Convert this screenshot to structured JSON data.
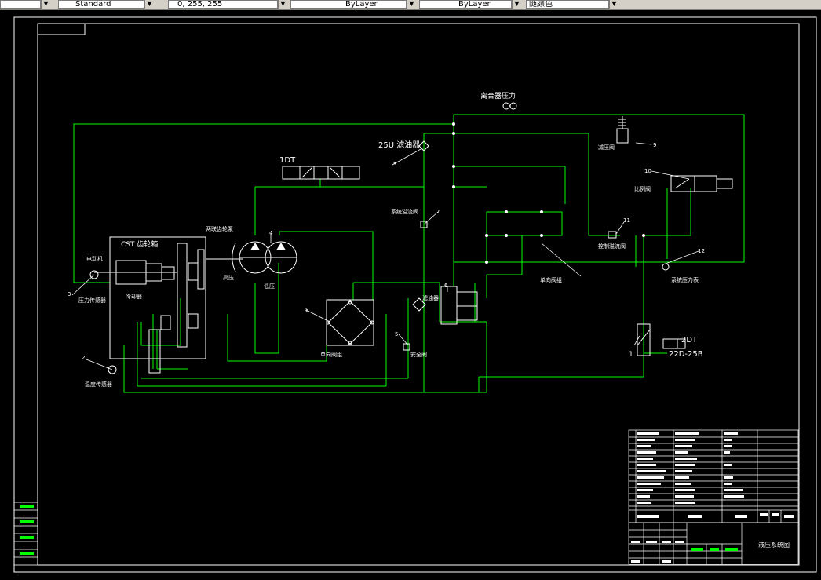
{
  "toolbar": {
    "textstyle_value": "Standard",
    "color_value": "0, 255, 255",
    "linetype_value": "ByLayer",
    "lineweight_value": "ByLayer",
    "plotstyle_value": "随颜色"
  },
  "diagram": {
    "title": "离合器压力",
    "labels": {
      "filter_25u": "25U 滤油器",
      "solenoid_1dt": "1DT",
      "cst": "CST 齿轮箱",
      "dual_pump": "两联齿轮泵",
      "high_pressure": "高压",
      "low_pressure": "低压",
      "system_overflow_valve": "系统溢流阀",
      "check_valve_group_mid": "单向阀组",
      "check_valve_group_right": "单向阀组",
      "safety_valve": "安全阀",
      "reducing_valve": "减压阀",
      "proportional_valve": "比例阀",
      "control_overflow_valve": "控制溢流阀",
      "system_pressure_gauge": "系统压力表",
      "solenoid_2dt": "2DT",
      "valve_model": "22D-25B",
      "temp_sensor": "温度传感器",
      "cooler": "冷却器",
      "filter_small": "滤油器",
      "pressure_sensor": "压力传感器",
      "motor": "电动机"
    },
    "numbers": {
      "n1": "1",
      "n2": "2",
      "n3": "3",
      "n4": "4",
      "n5": "5",
      "n6": "6",
      "n7": "7",
      "n8": "8",
      "n9": "9",
      "n10": "10",
      "n11": "11",
      "n12": "12"
    }
  },
  "title_block": {
    "drawing_name": "液压系统图"
  },
  "colors": {
    "background": "#000000",
    "line": "#00ff00",
    "text": "#ffffff",
    "accent": "#00ffff",
    "frame": "#ffffff"
  }
}
